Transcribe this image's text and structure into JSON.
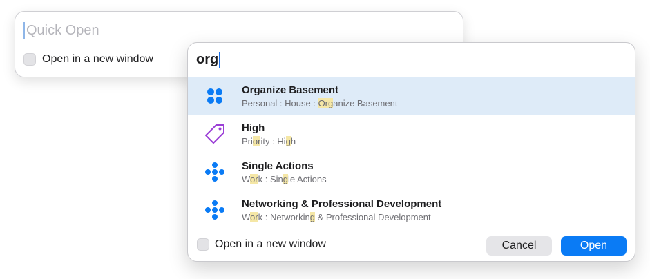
{
  "back_panel": {
    "placeholder": "Quick Open",
    "checkbox_label": "Open in a new window"
  },
  "front_panel": {
    "query": "org",
    "results": [
      {
        "icon": "project-group-icon",
        "title": "Organize Basement",
        "path": [
          {
            "t": "Personal : House : ",
            "h": false
          },
          {
            "t": "Org",
            "h": true
          },
          {
            "t": "anize Basement",
            "h": false
          }
        ],
        "selected": true
      },
      {
        "icon": "tag-icon",
        "title": "High",
        "path": [
          {
            "t": "Pri",
            "h": false
          },
          {
            "t": "or",
            "h": true
          },
          {
            "t": "ity : Hi",
            "h": false
          },
          {
            "t": "g",
            "h": true
          },
          {
            "t": "h",
            "h": false
          }
        ],
        "selected": false
      },
      {
        "icon": "single-actions-icon",
        "title": "Single Actions",
        "path": [
          {
            "t": "W",
            "h": false
          },
          {
            "t": "or",
            "h": true
          },
          {
            "t": "k : Sin",
            "h": false
          },
          {
            "t": "g",
            "h": true
          },
          {
            "t": "le Actions",
            "h": false
          }
        ],
        "selected": false
      },
      {
        "icon": "single-actions-icon",
        "title": "Networking & Professional Development",
        "path": [
          {
            "t": "W",
            "h": false
          },
          {
            "t": "or",
            "h": true
          },
          {
            "t": "k : Networkin",
            "h": false
          },
          {
            "t": "g",
            "h": true
          },
          {
            "t": " & Professional Development",
            "h": false
          }
        ],
        "selected": false
      }
    ],
    "footer": {
      "checkbox_label": "Open in a new window",
      "cancel_label": "Cancel",
      "open_label": "Open"
    }
  },
  "colors": {
    "accent": "#0a7bf5",
    "selected_row": "#deebf8",
    "highlight": "#f5e7a6",
    "tag": "#9b3fd6"
  }
}
